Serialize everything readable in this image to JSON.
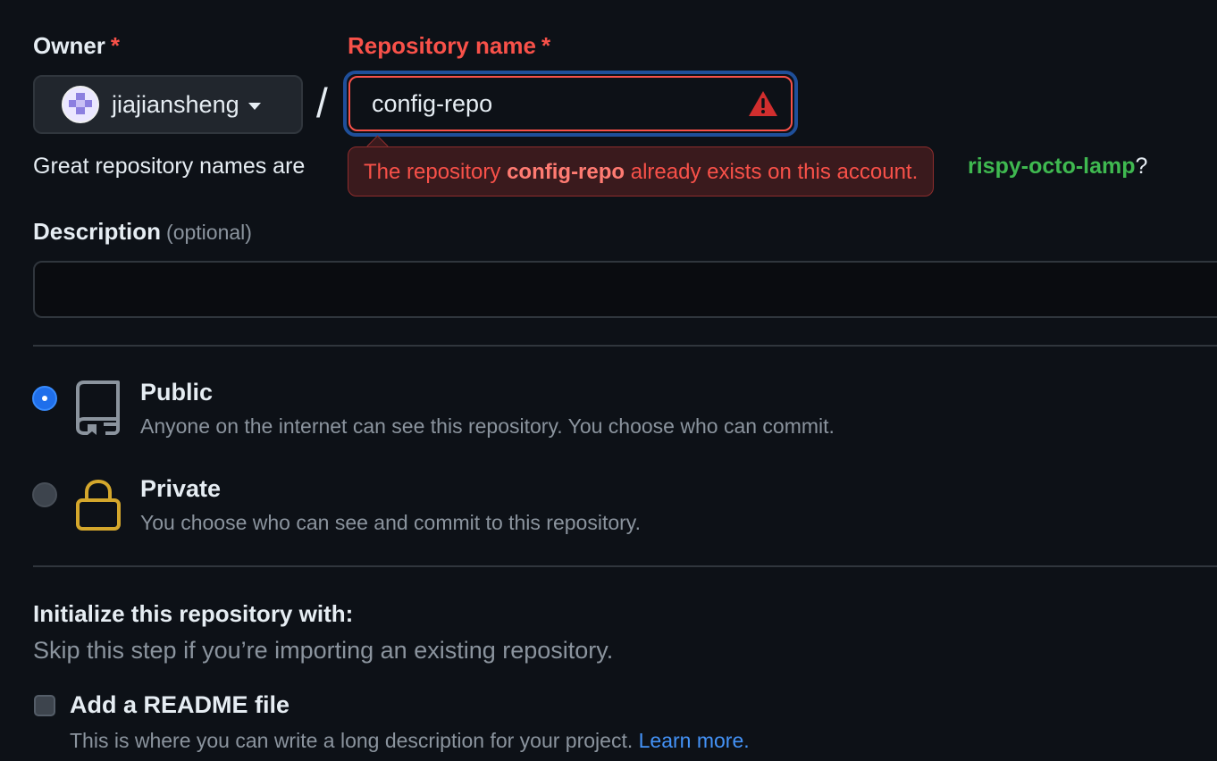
{
  "owner": {
    "label": "Owner",
    "required_mark": "*",
    "selected": "jiajiansheng"
  },
  "separator": "/",
  "repo_name": {
    "label": "Repository name",
    "required_mark": "*",
    "value": "config-repo"
  },
  "error_tooltip": {
    "prefix": "The repository ",
    "repo": "config-repo",
    "suffix": " already exists on this account."
  },
  "hint": {
    "text": "Great repository names are",
    "suggestion": "rispy-octo-lamp",
    "trailing": "?"
  },
  "description": {
    "label": "Description",
    "optional": "(optional)",
    "value": ""
  },
  "visibility": {
    "public": {
      "title": "Public",
      "desc": "Anyone on the internet can see this repository. You choose who can commit.",
      "selected": true
    },
    "private": {
      "title": "Private",
      "desc": "You choose who can see and commit to this repository.",
      "selected": false
    }
  },
  "initialize": {
    "title": "Initialize this repository with:",
    "subtitle": "Skip this step if you’re importing an existing repository.",
    "readme": {
      "title": "Add a README file",
      "desc": "This is where you can write a long description for your project.",
      "link": "Learn more.",
      "checked": false
    }
  },
  "colors": {
    "background": "#0d1117",
    "error": "#f85149",
    "accent": "#1f6feb",
    "suggestion": "#3fb950",
    "link": "#4493f8"
  },
  "icons": {
    "repo": "repo-book-icon",
    "lock": "lock-icon",
    "warning": "alert-triangle-icon"
  }
}
